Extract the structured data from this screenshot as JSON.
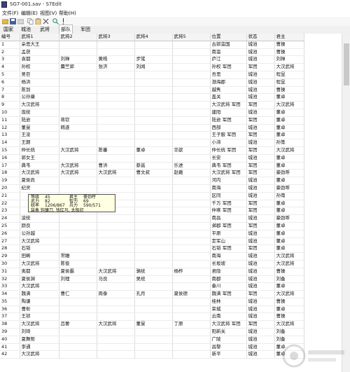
{
  "window": {
    "title": "SG7-001.sav - S7Edit"
  },
  "menu": [
    "文件(F)",
    "编辑(E)",
    "视图(V)",
    "帮助(H)"
  ],
  "toolbar": [
    "open-icon",
    "save-icon",
    "folder-icon",
    "copy-icon",
    "paste-icon",
    "delete-icon",
    "find-icon",
    "help-icon"
  ],
  "tabs": [
    "国家",
    "城池",
    "武将",
    "部队",
    "军团"
  ],
  "active_tab": "部队",
  "columns": [
    "编号",
    "武将1",
    "武将2",
    "武将3",
    "武将4",
    "武将5",
    "位置",
    "状态",
    "君主"
  ],
  "rows": [
    [
      "1",
      "朵思大王",
      "",
      "",
      "",
      "",
      "古郎蛮国",
      "城池",
      "曹操"
    ],
    [
      "2",
      "孟获",
      "",
      "",
      "",
      "",
      "南蛮",
      "城池",
      "曹操"
    ],
    [
      "3",
      "袁都",
      "刘禅",
      "黄皓",
      "步骘",
      "",
      "庐江",
      "城池",
      "刘禅"
    ],
    [
      "4",
      "孙权",
      "麋竺郭",
      "张济",
      "刘闻",
      "",
      "孙权 军团",
      "军团",
      "大汉武将"
    ],
    [
      "5",
      "吴巨",
      "",
      "",
      "",
      "",
      "吾思",
      "城池",
      "程昱"
    ],
    [
      "6",
      "杨洪",
      "",
      "",
      "",
      "",
      "渤海郡",
      "城池",
      "程昱"
    ],
    [
      "7",
      "陈到",
      "",
      "",
      "",
      "",
      "越隽",
      "城池",
      "曹操"
    ],
    [
      "8",
      "公孙康",
      "",
      "",
      "",
      "",
      "盖关",
      "城池",
      "董卓"
    ],
    [
      "9",
      "大汉武将",
      "",
      "",
      "",
      "",
      "大汉武将 军团",
      "军团",
      "大汉武将"
    ],
    [
      "10",
      "庞统",
      "",
      "",
      "",
      "",
      "建阳",
      "城池",
      "董卓"
    ],
    [
      "11",
      "陆逊",
      "蒋钦",
      "",
      "",
      "",
      "陆逊 军团",
      "军团",
      "董卓"
    ],
    [
      "12",
      "董旻",
      "韩遂",
      "",
      "",
      "",
      "西部",
      "城池",
      "董卓"
    ],
    [
      "13",
      "王浚",
      "",
      "",
      "",
      "",
      "王子服 军团",
      "军团",
      "董卓"
    ],
    [
      "14",
      "王朗",
      "",
      "",
      "",
      "",
      "小沛",
      "城池",
      "孙策"
    ],
    [
      "15",
      "仲长统",
      "大汉武将",
      "陈蕃",
      "董卓",
      "华歆",
      "仲长统 军团",
      "军团",
      "大汉武将"
    ],
    [
      "16",
      "郭女王",
      "",
      "",
      "",
      "",
      "长安",
      "城池",
      "董卓"
    ],
    [
      "17",
      "典韦",
      "大汉武将",
      "曹洪",
      "蔡邕",
      "乐进",
      "典韦 军团",
      "军团",
      "董卓"
    ],
    [
      "18",
      "大汉武将",
      "大汉武将",
      "大汉武将",
      "曹文叔",
      "赵戴",
      "大汉武将 军团",
      "军团",
      "豪劲呼"
    ],
    [
      "19",
      "夏侯尚",
      "",
      "",
      "",
      "",
      "河内",
      "城池",
      "董卓"
    ],
    [
      "20",
      "纪灵",
      "",
      "",
      "",
      "",
      "南海",
      "城池",
      "豪劲呼"
    ],
    [
      "21",
      "",
      "",
      "",
      "",
      "",
      "区同",
      "城池",
      "孙南"
    ],
    [
      "22",
      "",
      "",
      "",
      "",
      "",
      "千万 军团",
      "军团",
      "董卓"
    ],
    [
      "23",
      "",
      "",
      "",
      "",
      "",
      "仲寒 军团",
      "军团",
      "董卓"
    ],
    [
      "24",
      "凌统",
      "",
      "",
      "",
      "",
      "南昌",
      "城池",
      "豪劲呼"
    ],
    [
      "25",
      "颜良",
      "",
      "",
      "",
      "",
      "邺郡 军团",
      "军团",
      "董卓"
    ],
    [
      "26",
      "公孙越",
      "",
      "",
      "",
      "",
      "平原",
      "城池",
      "董卓"
    ],
    [
      "27",
      "大汉武将",
      "",
      "",
      "",
      "",
      "定军山",
      "城池",
      "董卓"
    ],
    [
      "28",
      "石韬",
      "",
      "",
      "",
      "",
      "石韬 军团",
      "军团",
      "董卓"
    ],
    [
      "29",
      "田畴",
      "常雕",
      "",
      "",
      "",
      "南海",
      "城池",
      "大汉武将"
    ],
    [
      "30",
      "大汉武将",
      "陈俊",
      "",
      "",
      "",
      "长坂坡",
      "城池",
      "大汉武将"
    ],
    [
      "31",
      "夷都",
      "夏侯霸",
      "大汉武将",
      "骆统",
      "杨柞",
      "君隐",
      "城池",
      "曹操"
    ],
    [
      "32",
      "夏侯渊",
      "刘理",
      "马良",
      "吴班",
      "",
      "南郡",
      "城池",
      "刘备"
    ],
    [
      "33",
      "大汉武将",
      "",
      "",
      "",
      "",
      "秦川",
      "城池",
      "董卓"
    ],
    [
      "34",
      "魏满",
      "曹仁",
      "周泰",
      "孔月",
      "夏侯德",
      "魏满 军团",
      "军团",
      "大汉武将"
    ],
    [
      "35",
      "陶谦",
      "",
      "",
      "",
      "",
      "桂林",
      "城池",
      "曹操"
    ],
    [
      "36",
      "曹彰",
      "",
      "",
      "",
      "",
      "荣城",
      "城池",
      "董卓"
    ],
    [
      "37",
      "王祯",
      "",
      "",
      "",
      "",
      "云南",
      "城池",
      "曹操"
    ],
    [
      "38",
      "大汉武将",
      "吕奢",
      "大汉武将",
      "董旻",
      "丁原",
      "大汉武将 军团",
      "军团",
      "大汉武将"
    ],
    [
      "39",
      "刘琦",
      "",
      "",
      "",
      "",
      "阳新关",
      "城池",
      "刘备"
    ],
    [
      "40",
      "夏舞矩",
      "",
      "",
      "",
      "",
      "广陵",
      "城池",
      "刘备"
    ],
    [
      "41",
      "李通",
      "",
      "",
      "",
      "",
      "昌黎",
      "城池",
      "董卓"
    ],
    [
      "42",
      "大汉武将",
      "",
      "",
      "",
      "",
      "新平",
      "城池",
      "董卓"
    ]
  ],
  "tooltip": {
    "row1": {
      "a_label": "等级",
      "a_value": "45",
      "b_label": "君主",
      "b_value": "豪劲呼"
    },
    "row2": {
      "a_label": "武力",
      "a_value": "82",
      "b_label": "智力",
      "b_value": "69"
    },
    "row3": {
      "a_label": "统率",
      "a_value": "1206/867",
      "b_label": "兵力",
      "b_value": "590/571"
    },
    "row4": {
      "text": "装备 钩镰刀, 钱红马, 太极印"
    }
  }
}
